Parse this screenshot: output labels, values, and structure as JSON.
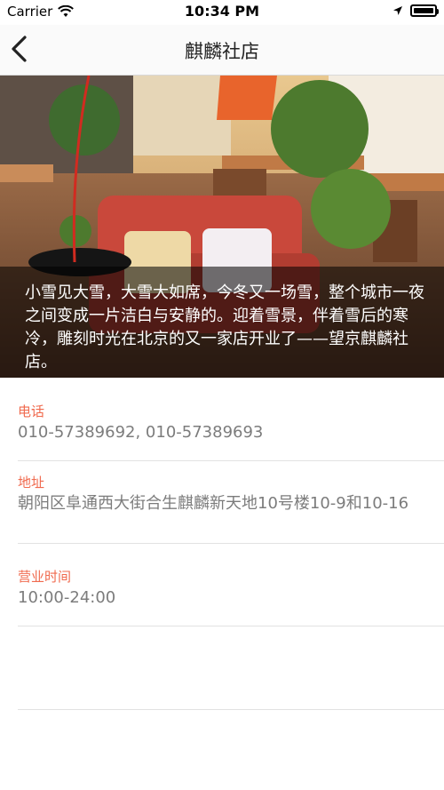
{
  "status_bar": {
    "carrier": "Carrier",
    "time": "10:34 PM"
  },
  "nav": {
    "title": "麒麟社店"
  },
  "hero": {
    "description": "小雪见大雪，大雪大如席，今冬又一场雪，整个城市一夜之间变成一片洁白与安静的。迎着雪景，伴着雪后的寒冷，雕刻时光在北京的又一家店开业了——望京麒麟社店。"
  },
  "info": [
    {
      "label": "电话",
      "value": "010-57389692, 010-57389693"
    },
    {
      "label": "地址",
      "value": "朝阳区阜通西大街合生麒麟新天地10号楼10-9和10-16"
    },
    {
      "label": "营业时间",
      "value": "10:00-24:00"
    }
  ],
  "colors": {
    "accent": "#f06a4e",
    "value_text": "#7c7c7c",
    "divider": "#e2e2e2"
  }
}
